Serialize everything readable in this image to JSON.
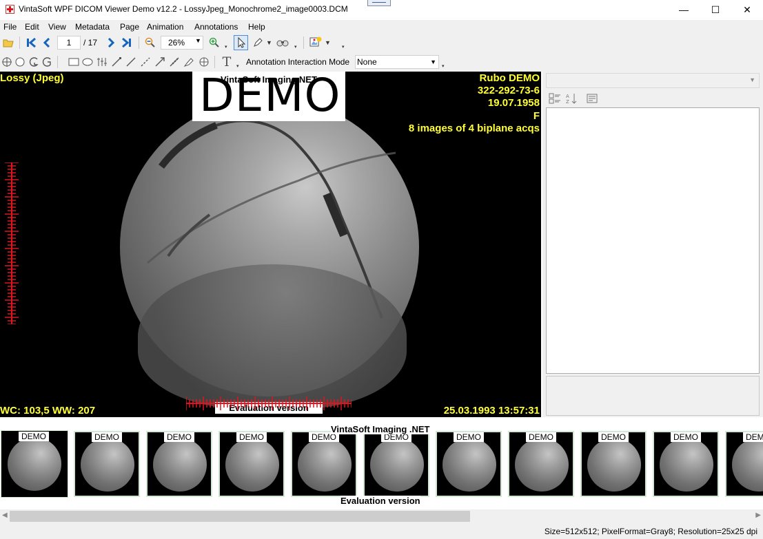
{
  "window": {
    "title": "VintaSoft WPF DICOM Viewer Demo v12.2 - LossyJpeg_Monochrome2_image0003.DCM",
    "minimize": "—",
    "maximize": "☐",
    "close": "✕"
  },
  "menu": [
    "File",
    "Edit",
    "View",
    "Metadata",
    "Page",
    "Animation",
    "Annotations",
    "Help"
  ],
  "toolbar": {
    "page_current": "1",
    "page_total": "/ 17",
    "zoom": "26%",
    "annotation_mode_label": "Annotation Interaction Mode",
    "annotation_mode_value": "None"
  },
  "viewer": {
    "top_left": "Lossy (Jpeg)",
    "patient_name": "Rubo DEMO",
    "patient_id": "322-292-73-6",
    "birth_date": "19.07.1958",
    "sex": "F",
    "series_desc": "8 images of 4 biplane acqs",
    "window_level": "WC: 103,5 WW: 207",
    "datetime": "25.03.1993 13:57:31",
    "watermark_top": "VintaSoft Imaging.NET",
    "watermark_big": "DEMO",
    "watermark_bottom": "Evaluation version"
  },
  "thumbnails": {
    "label": "DEMO",
    "watermark_top": "VintaSoft Imaging .NET",
    "watermark_bottom": "Evaluation version"
  },
  "status": {
    "info": "Size=512x512; PixelFormat=Gray8; Resolution=25x25 dpi"
  },
  "colors": {
    "overlay_text": "#ffff33",
    "ruler": "#e0141e",
    "nav_icons": "#1565c0"
  }
}
